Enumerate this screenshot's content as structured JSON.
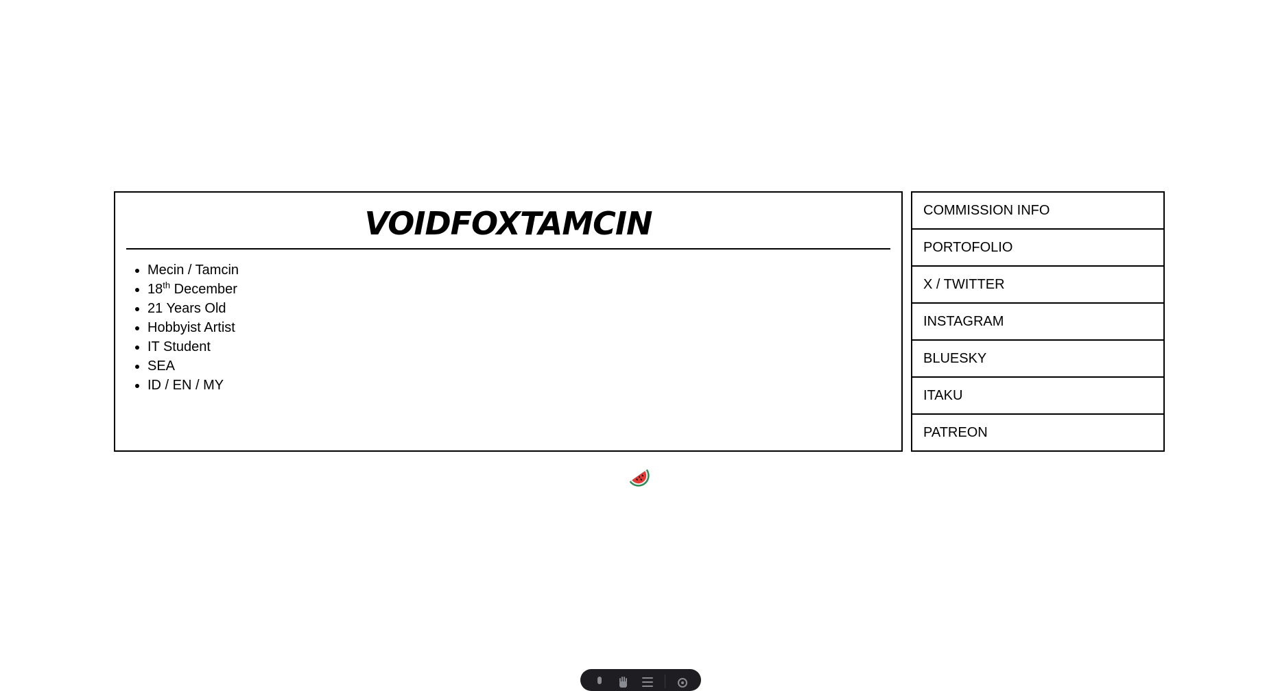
{
  "profile": {
    "title": "VOIDFOXTAMCIN",
    "items": [
      {
        "text": "Mecin / Tamcin"
      },
      {
        "day": "18",
        "suffix": "th",
        "rest": " December"
      },
      {
        "text": "21 Years Old"
      },
      {
        "text": "Hobbyist Artist"
      },
      {
        "text": "IT Student"
      },
      {
        "text": "SEA"
      },
      {
        "text": "ID / EN / MY"
      }
    ]
  },
  "links": [
    {
      "label": "COMMISSION INFO"
    },
    {
      "label": "PORTOFOLIO"
    },
    {
      "label": "X / TWITTER"
    },
    {
      "label": "INSTAGRAM"
    },
    {
      "label": "BLUESKY"
    },
    {
      "label": "ITAKU"
    },
    {
      "label": "PATREON"
    }
  ],
  "footer": {
    "emblem_icon": "watermelon-icon"
  },
  "toolbar": {
    "icons": [
      "microphone-icon",
      "hand-icon",
      "menu-icon",
      "settings-icon"
    ],
    "background": "#1e1e22"
  },
  "colors": {
    "border": "#000000",
    "text": "#000000",
    "background": "#ffffff"
  }
}
